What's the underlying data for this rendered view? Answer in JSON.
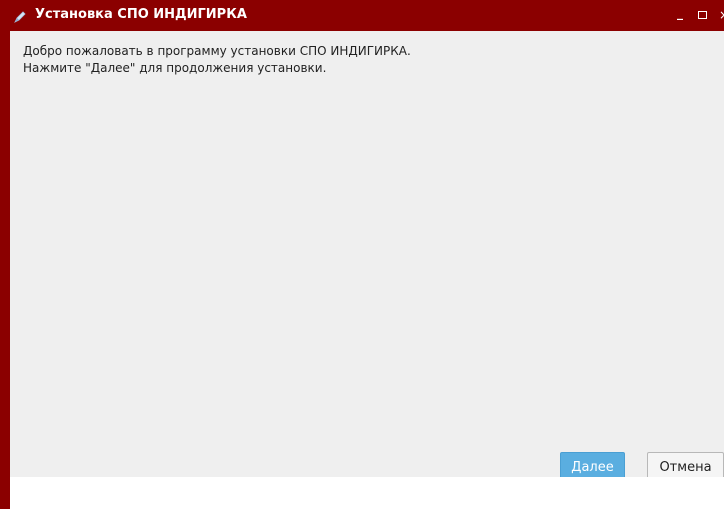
{
  "window": {
    "title": "Установка СПО ИНДИГИРКА",
    "title_icon": "installer-icon",
    "controls": {
      "minimize": "_",
      "close": "×"
    },
    "accent_color": "#8b0000"
  },
  "content": {
    "welcome_line_1": "Добро пожаловать в программу установки СПО ИНДИГИРКА.",
    "welcome_line_2": "Нажмите \"Далее\" для продолжения установки."
  },
  "buttons": {
    "next_label": "Далее",
    "cancel_label": "Отмена",
    "next_color": "#5aaee0"
  }
}
